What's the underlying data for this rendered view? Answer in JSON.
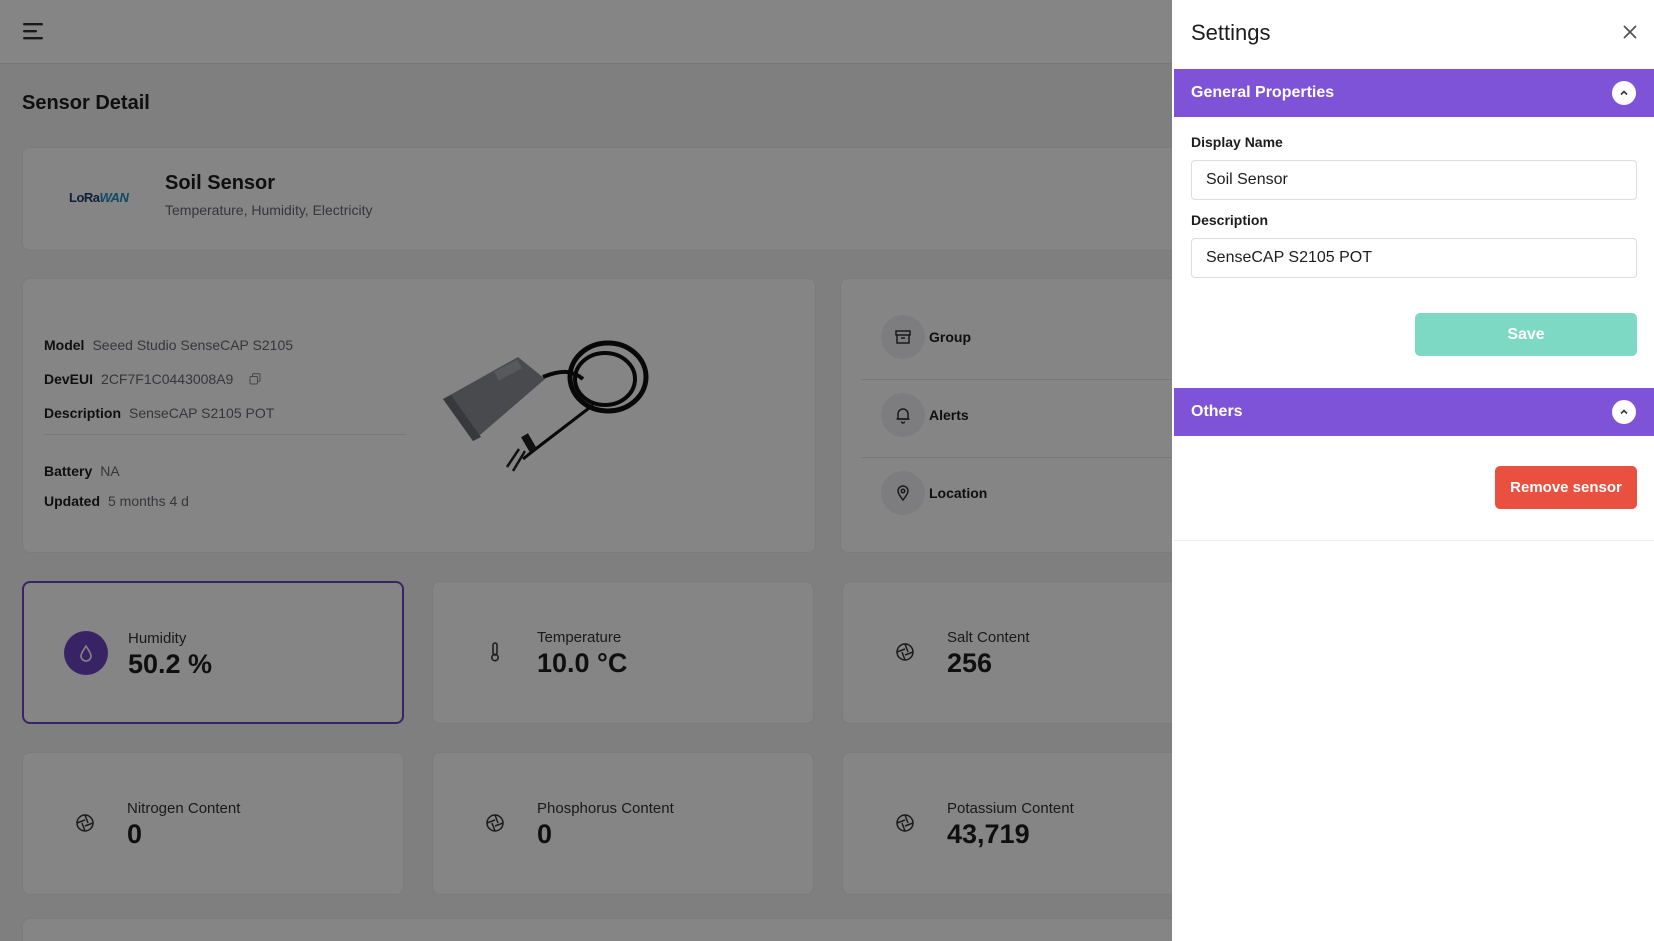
{
  "page": {
    "title": "Sensor Detail"
  },
  "device": {
    "logo_text_a": "LoRa",
    "logo_text_b": "WAN",
    "name": "Soil Sensor",
    "subtitle": "Temperature, Humidity, Electricity"
  },
  "info": {
    "model_label": "Model",
    "model_value": "Seeed Studio SenseCAP S2105",
    "deveui_label": "DevEUI",
    "deveui_value": "2CF7F1C0443008A9",
    "description_label": "Description",
    "description_value": "SenseCAP S2105 POT",
    "battery_label": "Battery",
    "battery_value": "NA",
    "updated_label": "Updated",
    "updated_value": "5 months 4 d"
  },
  "links": [
    {
      "label": "Group",
      "icon": "archive-icon"
    },
    {
      "label": "Alerts",
      "icon": "bell-icon"
    },
    {
      "label": "Location",
      "icon": "map-pin-icon"
    }
  ],
  "metrics": [
    {
      "label": "Humidity",
      "value": "50.2 %",
      "icon": "droplet-icon",
      "active": true
    },
    {
      "label": "Temperature",
      "value": "10.0 °C",
      "icon": "thermometer-icon",
      "active": false
    },
    {
      "label": "Salt Content",
      "value": "256",
      "icon": "aperture-icon",
      "active": false
    },
    {
      "label": "Nitrogen Content",
      "value": "0",
      "icon": "aperture-icon",
      "active": false
    },
    {
      "label": "Phosphorus Content",
      "value": "0",
      "icon": "aperture-icon",
      "active": false
    },
    {
      "label": "Potassium Content",
      "value": "43,719",
      "icon": "aperture-icon",
      "active": false
    }
  ],
  "settings": {
    "title": "Settings",
    "general_section": "General Properties",
    "display_name_label": "Display Name",
    "display_name_value": "Soil Sensor",
    "description_label": "Description",
    "description_value": "SenseCAP S2105 POT",
    "save_label": "Save",
    "others_section": "Others",
    "remove_label": "Remove sensor"
  },
  "colors": {
    "accent": "#7f53d8",
    "save": "#7dd9c4",
    "danger": "#e9503f"
  }
}
